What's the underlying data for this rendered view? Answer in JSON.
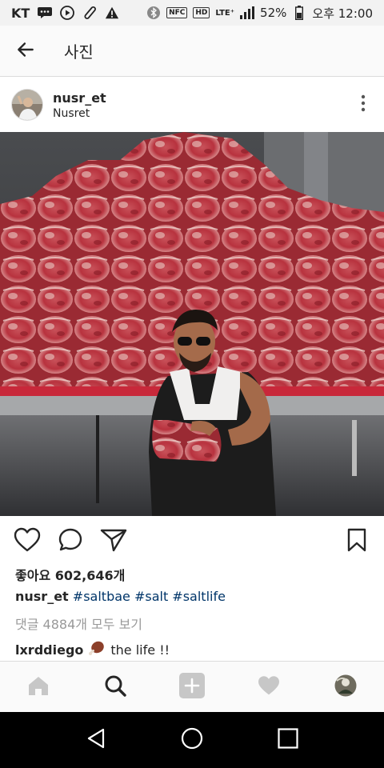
{
  "status_bar": {
    "carrier": "KT",
    "battery": "52%",
    "time": "오후 12:00",
    "nfc_tag": "NFC",
    "hd_tag": "HD",
    "lte_tag": "LTE⁺"
  },
  "app_bar": {
    "title": "사진"
  },
  "post": {
    "username": "nusr_et",
    "location": "Nusret",
    "likes": "좋아요 602,646개",
    "caption_user": "nusr_et",
    "caption_tags": "#saltbae #salt #saltlife",
    "view_comments": "댓글 4884개 모두 보기",
    "comment_user": "lxrddiego",
    "comment_text": "the life !!"
  },
  "icons": {
    "back": "arrow-left-icon",
    "more": "more-vertical-icon",
    "like": "heart-outline-icon",
    "comment": "speech-bubble-icon",
    "share": "paper-plane-icon",
    "save": "bookmark-icon",
    "home": "home-icon",
    "search": "search-icon",
    "add": "plus-square-icon",
    "activity": "heart-icon",
    "profile": "profile-avatar-icon"
  },
  "colors": {
    "hashtag": "#003569",
    "muted": "#999999",
    "tab_inactive": "#c7c7c7"
  }
}
